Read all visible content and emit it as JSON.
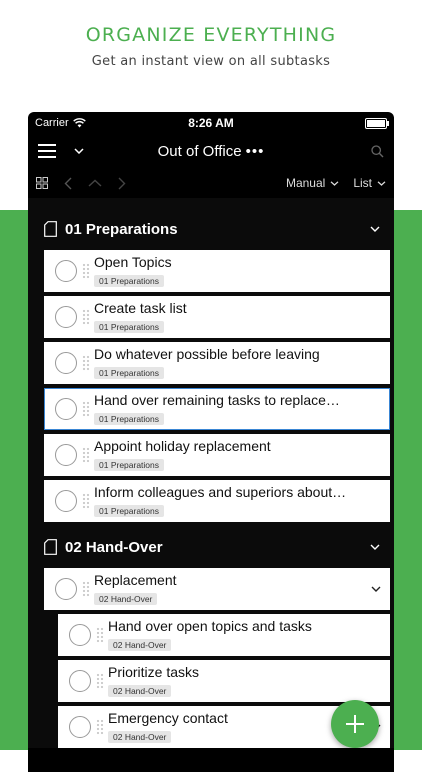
{
  "promo": {
    "title": "ORGANIZE EVERYTHING",
    "subtitle": "Get an instant view on all subtasks"
  },
  "status_bar": {
    "carrier": "Carrier",
    "time": "8:26 AM"
  },
  "nav": {
    "title": "Out of Office",
    "more": "•••"
  },
  "toolbar": {
    "sort_label": "Manual",
    "view_label": "List"
  },
  "groups": [
    {
      "title": "01 Preparations",
      "tasks": [
        {
          "title": "Open Topics",
          "tag": "01 Preparations"
        },
        {
          "title": "Create task list",
          "tag": "01 Preparations"
        },
        {
          "title": "Do whatever possible before leaving",
          "tag": "01 Preparations"
        },
        {
          "title": "Hand over remaining tasks to replace…",
          "tag": "01 Preparations"
        },
        {
          "title": "Appoint holiday replacement",
          "tag": "01 Preparations"
        },
        {
          "title": "Inform colleagues and superiors about…",
          "tag": "01 Preparations"
        }
      ]
    },
    {
      "title": "02 Hand-Over",
      "tasks": [
        {
          "title": "Replacement",
          "tag": "02 Hand-Over"
        },
        {
          "title": "Hand over open topics and tasks",
          "tag": "02 Hand-Over"
        },
        {
          "title": "Prioritize tasks",
          "tag": "02 Hand-Over"
        },
        {
          "title": "Emergency contact",
          "tag": "02 Hand-Over"
        }
      ]
    }
  ],
  "colors": {
    "accent_green": "#4caf50",
    "selection_blue": "#3a86d4",
    "app_background": "#000000"
  }
}
